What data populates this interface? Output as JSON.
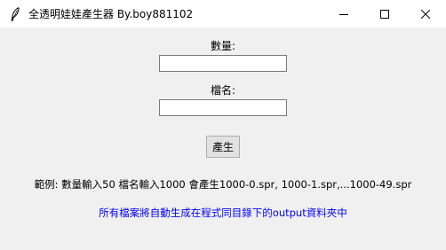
{
  "window": {
    "title": "全透明娃娃產生器 By.boy881102",
    "icon": "feather-icon"
  },
  "titlebar_controls": {
    "minimize": "minimize-icon",
    "maximize": "maximize-icon",
    "close": "close-icon"
  },
  "form": {
    "quantity_label": "數量:",
    "quantity_value": "",
    "filename_label": "檔名:",
    "filename_value": "",
    "generate_button": "產生"
  },
  "info": {
    "example_text": "範例: 數量輸入50 檔名輸入1000 會產生1000-0.spr, 1000-1.spr,...1000-49.spr",
    "note_text": "所有檔案將自動生成在程式同目錄下的output資料夾中",
    "note_color": "#0000ff"
  }
}
